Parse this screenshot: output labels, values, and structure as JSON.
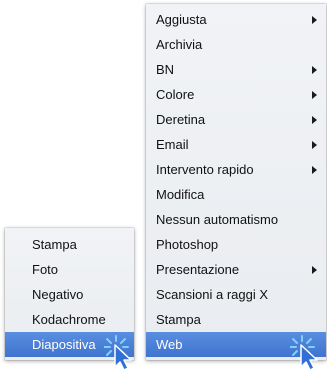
{
  "left_menu": {
    "items": [
      {
        "label": "Stampa",
        "selected": false
      },
      {
        "label": "Foto",
        "selected": false
      },
      {
        "label": "Negativo",
        "selected": false
      },
      {
        "label": "Kodachrome",
        "selected": false
      },
      {
        "label": "Diapositiva",
        "selected": true
      }
    ]
  },
  "right_menu": {
    "items": [
      {
        "label": "Aggiusta",
        "submenu": true,
        "selected": false
      },
      {
        "label": "Archivia",
        "submenu": false,
        "selected": false
      },
      {
        "label": "BN",
        "submenu": true,
        "selected": false
      },
      {
        "label": "Colore",
        "submenu": true,
        "selected": false
      },
      {
        "label": "Deretina",
        "submenu": true,
        "selected": false
      },
      {
        "label": "Email",
        "submenu": true,
        "selected": false
      },
      {
        "label": "Intervento rapido",
        "submenu": true,
        "selected": false
      },
      {
        "label": "Modifica",
        "submenu": false,
        "selected": false
      },
      {
        "label": "Nessun automatismo",
        "submenu": false,
        "selected": false
      },
      {
        "label": "Photoshop",
        "submenu": false,
        "selected": false
      },
      {
        "label": "Presentazione",
        "submenu": true,
        "selected": false
      },
      {
        "label": "Scansioni a raggi X",
        "submenu": false,
        "selected": false
      },
      {
        "label": "Stampa",
        "submenu": false,
        "selected": false
      },
      {
        "label": "Web",
        "submenu": false,
        "selected": true
      }
    ]
  },
  "colors": {
    "selection": "#4a80d8",
    "menu_background": "#eceef2",
    "cursor_fill": "#2f6fd6",
    "click_burst": "#7fd0ff"
  },
  "icons": {
    "cursor": "mouse-pointer-click-icon",
    "submenu": "triangle-right-icon"
  }
}
